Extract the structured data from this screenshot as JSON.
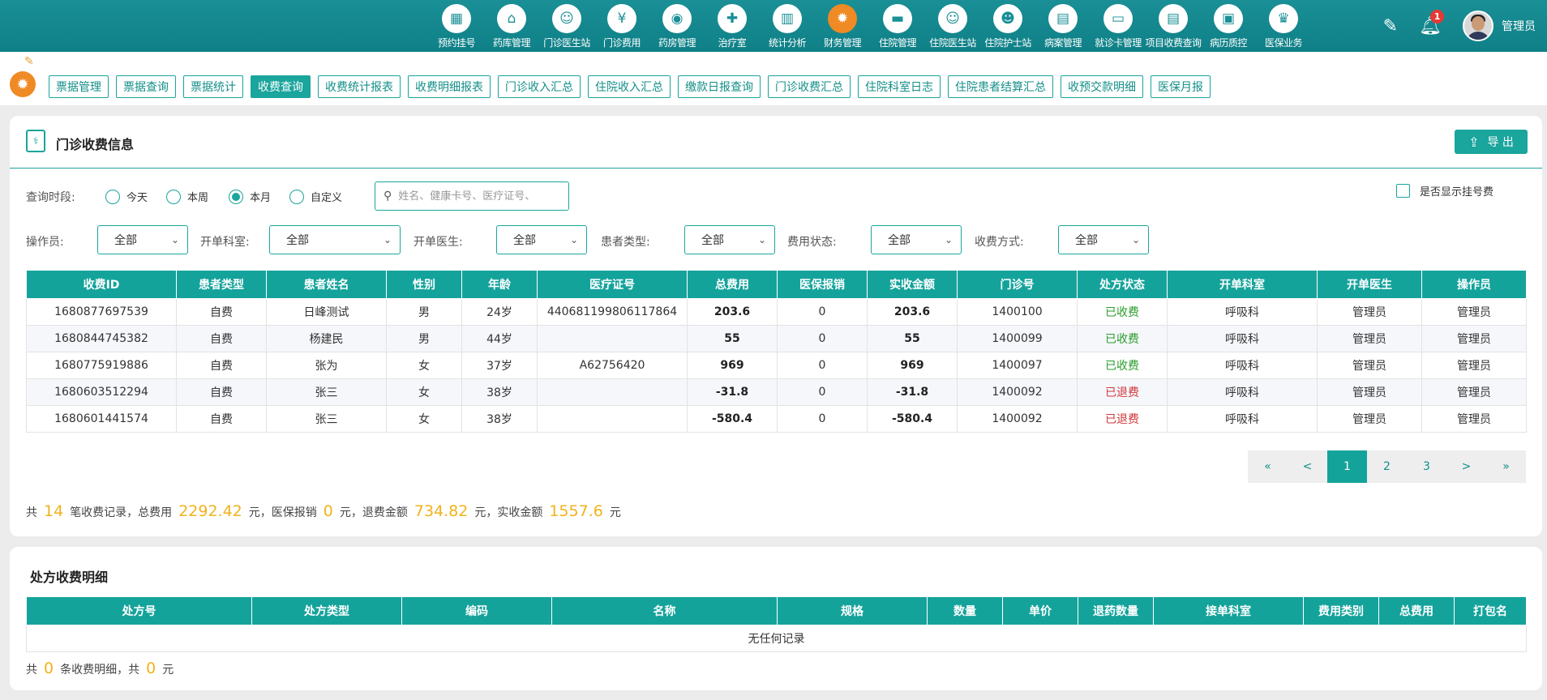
{
  "nav": {
    "items": [
      {
        "label": "预约挂号",
        "icon": "calendar-icon",
        "glyph": "▦"
      },
      {
        "label": "药库管理",
        "icon": "warehouse-icon",
        "glyph": "⌂"
      },
      {
        "label": "门诊医生站",
        "icon": "doctor-icon",
        "glyph": "☺"
      },
      {
        "label": "门诊费用",
        "icon": "yen-icon",
        "glyph": "¥"
      },
      {
        "label": "药房管理",
        "icon": "pill-icon",
        "glyph": "◉"
      },
      {
        "label": "治疗室",
        "icon": "nurse-icon",
        "glyph": "✚"
      },
      {
        "label": "统计分析",
        "icon": "bar-chart-icon",
        "glyph": "▥"
      },
      {
        "label": "财务管理",
        "icon": "gear-icon",
        "glyph": "✹"
      },
      {
        "label": "住院管理",
        "icon": "bed-icon",
        "glyph": "▬"
      },
      {
        "label": "住院医生站",
        "icon": "doctor-desk-icon",
        "glyph": "☺"
      },
      {
        "label": "住院护士站",
        "icon": "nurse-desk-icon",
        "glyph": "☻"
      },
      {
        "label": "病案管理",
        "icon": "record-icon",
        "glyph": "▤"
      },
      {
        "label": "就诊卡管理",
        "icon": "card-icon",
        "glyph": "▭"
      },
      {
        "label": "项目收费查询",
        "icon": "invoice-icon",
        "glyph": "▤"
      },
      {
        "label": "病历质控",
        "icon": "quality-icon",
        "glyph": "▣"
      },
      {
        "label": "医保业务",
        "icon": "insurance-icon",
        "glyph": "♛"
      }
    ],
    "active_index": 7,
    "user_name": "管理员",
    "notification_count": "1"
  },
  "subtabs": [
    "票据管理",
    "票据查询",
    "票据统计",
    "收费查询",
    "收费统计报表",
    "收费明细报表",
    "门诊收入汇总",
    "住院收入汇总",
    "缴款日报查询",
    "门诊收费汇总",
    "住院科室日志",
    "住院患者结算汇总",
    "收预交款明细",
    "医保月报"
  ],
  "subtab_active": "收费查询",
  "panel1": {
    "title": "门诊收费信息",
    "export_label": "导 出",
    "period_label": "查询时段:",
    "periods": [
      "今天",
      "本周",
      "本月",
      "自定义"
    ],
    "period_selected": "本月",
    "search_placeholder": "姓名、健康卡号、医疗证号、",
    "show_reg_fee_label": "是否显示挂号费",
    "filters": [
      {
        "label": "操作员:",
        "value": "全部"
      },
      {
        "label": "开单科室:",
        "value": "全部"
      },
      {
        "label": "开单医生:",
        "value": "全部"
      },
      {
        "label": "患者类型:",
        "value": "全部"
      },
      {
        "label": "费用状态:",
        "value": "全部"
      },
      {
        "label": "收费方式:",
        "value": "全部"
      }
    ],
    "columns": [
      "收费ID",
      "患者类型",
      "患者姓名",
      "性别",
      "年龄",
      "医疗证号",
      "总费用",
      "医保报销",
      "实收金额",
      "门诊号",
      "处方状态",
      "开单科室",
      "开单医生",
      "操作员"
    ],
    "rows": [
      [
        "1680877697539",
        "自费",
        "日峰测试",
        "男",
        "24岁",
        "440681199806117864",
        "203.6",
        "0",
        "203.6",
        "1400100",
        "已收费",
        "呼吸科",
        "管理员",
        "管理员"
      ],
      [
        "1680844745382",
        "自费",
        "杨建民",
        "男",
        "44岁",
        "",
        "55",
        "0",
        "55",
        "1400099",
        "已收费",
        "呼吸科",
        "管理员",
        "管理员"
      ],
      [
        "1680775919886",
        "自费",
        "张为",
        "女",
        "37岁",
        "A62756420",
        "969",
        "0",
        "969",
        "1400097",
        "已收费",
        "呼吸科",
        "管理员",
        "管理员"
      ],
      [
        "1680603512294",
        "自费",
        "张三",
        "女",
        "38岁",
        "",
        "-31.8",
        "0",
        "-31.8",
        "1400092",
        "已退费",
        "呼吸科",
        "管理员",
        "管理员"
      ],
      [
        "1680601441574",
        "自费",
        "张三",
        "女",
        "38岁",
        "",
        "-580.4",
        "0",
        "-580.4",
        "1400092",
        "已退费",
        "呼吸科",
        "管理员",
        "管理员"
      ]
    ],
    "pagination": [
      "«",
      "<",
      "1",
      "2",
      "3",
      ">",
      "»"
    ],
    "current_page": "1",
    "summary": {
      "t1": "共",
      "count": "14",
      "t2": "笔收费记录，总费用",
      "total": "2292.42",
      "t3": "元，医保报销",
      "insurance": "0",
      "t4": "元，退费金额",
      "refund": "734.82",
      "t5": "元，实收金额",
      "actual": "1557.6",
      "t6": "元"
    }
  },
  "panel2": {
    "title": "处方收费明细",
    "columns": [
      "处方号",
      "处方类型",
      "编码",
      "名称",
      "规格",
      "数量",
      "单价",
      "退药数量",
      "接单科室",
      "费用类别",
      "总费用",
      "打包名"
    ],
    "empty_text": "无任何记录",
    "summary": {
      "t1": "共",
      "count": "0",
      "t2": "条收费明细，共",
      "amount": "0",
      "t3": "元"
    }
  },
  "colors": {
    "primary": "#14a39b",
    "topbar": "#0f8087",
    "accent": "#f08a24",
    "highlight": "#f2b21b",
    "paid": "#2a9d2a",
    "refunded": "#d0373b"
  }
}
